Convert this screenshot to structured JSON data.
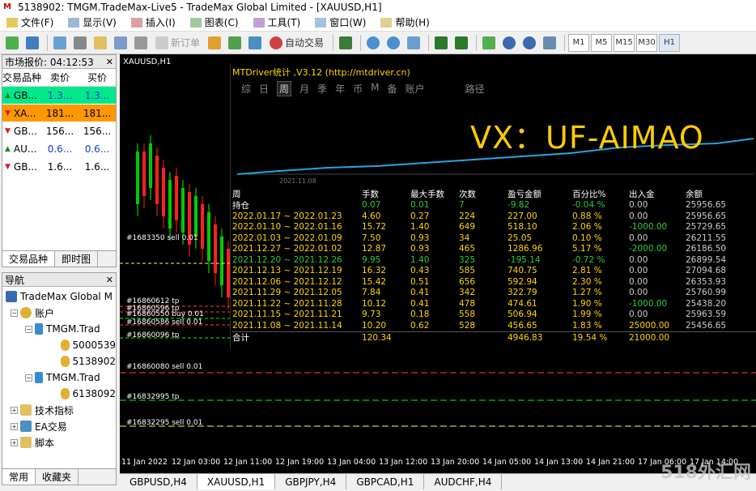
{
  "window": {
    "title": "5138902: TMGM.TradeMax-Live5 - TradeMax Global Limited - [XAUUSD,H1]"
  },
  "menu": [
    "文件(F)",
    "显示(V)",
    "插入(I)",
    "图表(C)",
    "工具(T)",
    "窗口(W)",
    "帮助(H)"
  ],
  "toolbar": {
    "new_order": "新订单",
    "auto_trade": "自动交易",
    "timeframes": [
      "M1",
      "M5",
      "M15",
      "M30",
      "H1"
    ]
  },
  "market": {
    "title": "市场报价: 04:12:53",
    "headers": [
      "交易品种",
      "卖价",
      "买价"
    ],
    "rows": [
      {
        "symbol": "GB...",
        "bid": "1.3...",
        "ask": "1.3...",
        "dir": "up",
        "bg": "#00e88a"
      },
      {
        "symbol": "XA...",
        "bid": "181...",
        "ask": "181...",
        "dir": "down",
        "bg": "#ff9800"
      },
      {
        "symbol": "GB...",
        "bid": "156...",
        "ask": "156...",
        "dir": "down",
        "bg": "#ffffff"
      },
      {
        "symbol": "AU...",
        "bid": "0.6...",
        "ask": "0.6...",
        "dir": "up",
        "bg": "#ffffff"
      },
      {
        "symbol": "GB...",
        "bid": "1.6...",
        "ask": "1.6...",
        "dir": "down",
        "bg": "#ffffff"
      }
    ],
    "tabs": [
      "交易品种",
      "即时图"
    ]
  },
  "navigator": {
    "title": "导航",
    "root": "TradeMax Global M",
    "accounts": "账户",
    "servers": [
      {
        "name": "TMGM.Trad",
        "accounts": [
          "5000539",
          "5138902"
        ]
      },
      {
        "name": "TMGM.Trad",
        "accounts": [
          "6138092"
        ]
      }
    ],
    "indicators": "技术指标",
    "ea": "EA交易",
    "scripts": "脚本",
    "tabs": [
      "常用",
      "收藏夹"
    ]
  },
  "chart": {
    "symbol_title": "XAUUSD,H1",
    "time_labels": [
      "11 Jan 2022",
      "12 Jan 03:00",
      "12 Jan 11:00",
      "12 Jan 19:00",
      "13 Jan 04:00",
      "13 Jan 12:00",
      "13 Jan 20:00",
      "14 Jan 05:00",
      "14 Jan 13:00",
      "14 Jan 21:00",
      "17 Jan 06:00",
      "17 Jan 14:00"
    ],
    "trade_labels": [
      "#1683350 sell 0.01",
      "#16860612 tp",
      "#16860596 tp",
      "#16860550 buy 0.01",
      "#16860586 sell 0.01",
      "#16860096 tp",
      "#16860080 sell 0.01",
      "#16832995 tp",
      "#16832295 sell 0.01",
      "#16830956 sell 0.01"
    ]
  },
  "stats_panel": {
    "title": "MTDriver统计 ,V3.12 (http://mtdriver.cn)",
    "nav": [
      "综",
      "日",
      "周",
      "月",
      "季",
      "年",
      "币",
      "M",
      "备",
      "账户",
      "路径"
    ],
    "selected_nav": "周",
    "watermark": "VX：UF-AIMAO",
    "date_label": "2021.11.08",
    "headers": [
      "周",
      "手数",
      "最大手数",
      "次数",
      "盈亏金额",
      "百分比%",
      "出入金",
      "余额"
    ],
    "holding": {
      "label": "持仓",
      "values": [
        "0.07",
        "0.01",
        "7",
        "-9.82",
        "-0.04 %",
        "0.00",
        "25956.65"
      ]
    },
    "rows": [
      {
        "period": "2022.01.17 ~ 2022.01.23",
        "lots": "4.60",
        "max": "0.27",
        "count": "224",
        "pnl": "227.00",
        "pct": "0.88 %",
        "io": "0.00",
        "bal": "25956.65"
      },
      {
        "period": "2022.01.10 ~ 2022.01.16",
        "lots": "15.72",
        "max": "1.40",
        "count": "649",
        "pnl": "518.10",
        "pct": "2.06 %",
        "io": "-1000.00",
        "bal": "25729.65"
      },
      {
        "period": "2022.01.03 ~ 2022.01.09",
        "lots": "7.50",
        "max": "0.93",
        "count": "34",
        "pnl": "25.05",
        "pct": "0.10 %",
        "io": "0.00",
        "bal": "26211.55"
      },
      {
        "period": "2021.12.27 ~ 2022.01.02",
        "lots": "12.87",
        "max": "0.93",
        "count": "465",
        "pnl": "1286.96",
        "pct": "5.17 %",
        "io": "-2000.00",
        "bal": "26186.50"
      },
      {
        "period": "2021.12.20 ~ 2021.12.26",
        "lots": "9.95",
        "max": "1.40",
        "count": "325",
        "pnl": "-195.14",
        "pct": "-0.72 %",
        "io": "0.00",
        "bal": "26899.54"
      },
      {
        "period": "2021.12.13 ~ 2021.12.19",
        "lots": "16.32",
        "max": "0.43",
        "count": "585",
        "pnl": "740.75",
        "pct": "2.81 %",
        "io": "0.00",
        "bal": "27094.68"
      },
      {
        "period": "2021.12.06 ~ 2021.12.12",
        "lots": "15.42",
        "max": "0.51",
        "count": "656",
        "pnl": "592.94",
        "pct": "2.30 %",
        "io": "0.00",
        "bal": "26353.93"
      },
      {
        "period": "2021.11.29 ~ 2021.12.05",
        "lots": "7.84",
        "max": "0.41",
        "count": "342",
        "pnl": "322.79",
        "pct": "1.27 %",
        "io": "0.00",
        "bal": "25760.99"
      },
      {
        "period": "2021.11.22 ~ 2021.11.28",
        "lots": "10.12",
        "max": "0.41",
        "count": "478",
        "pnl": "474.61",
        "pct": "1.90 %",
        "io": "-1000.00",
        "bal": "25438.20"
      },
      {
        "period": "2021.11.15 ~ 2021.11.21",
        "lots": "9.73",
        "max": "0.18",
        "count": "558",
        "pnl": "506.94",
        "pct": "1.99 %",
        "io": "0.00",
        "bal": "25963.59"
      },
      {
        "period": "2021.11.08 ~ 2021.11.14",
        "lots": "10.20",
        "max": "0.62",
        "count": "528",
        "pnl": "456.65",
        "pct": "1.83 %",
        "io": "25000.00",
        "bal": "25456.65"
      }
    ],
    "total": {
      "label": "合计",
      "lots": "120.34",
      "pnl": "4946.83",
      "pct": "19.54 %",
      "io": "21000.00"
    }
  },
  "chart_tabs": [
    "GBPUSD,H4",
    "XAUUSD,H1",
    "GBPJPY,H4",
    "GBPCAD,H1",
    "AUDCHF,H4"
  ],
  "active_chart_tab": "XAUUSD,H1",
  "site_watermark": "518外汇网"
}
